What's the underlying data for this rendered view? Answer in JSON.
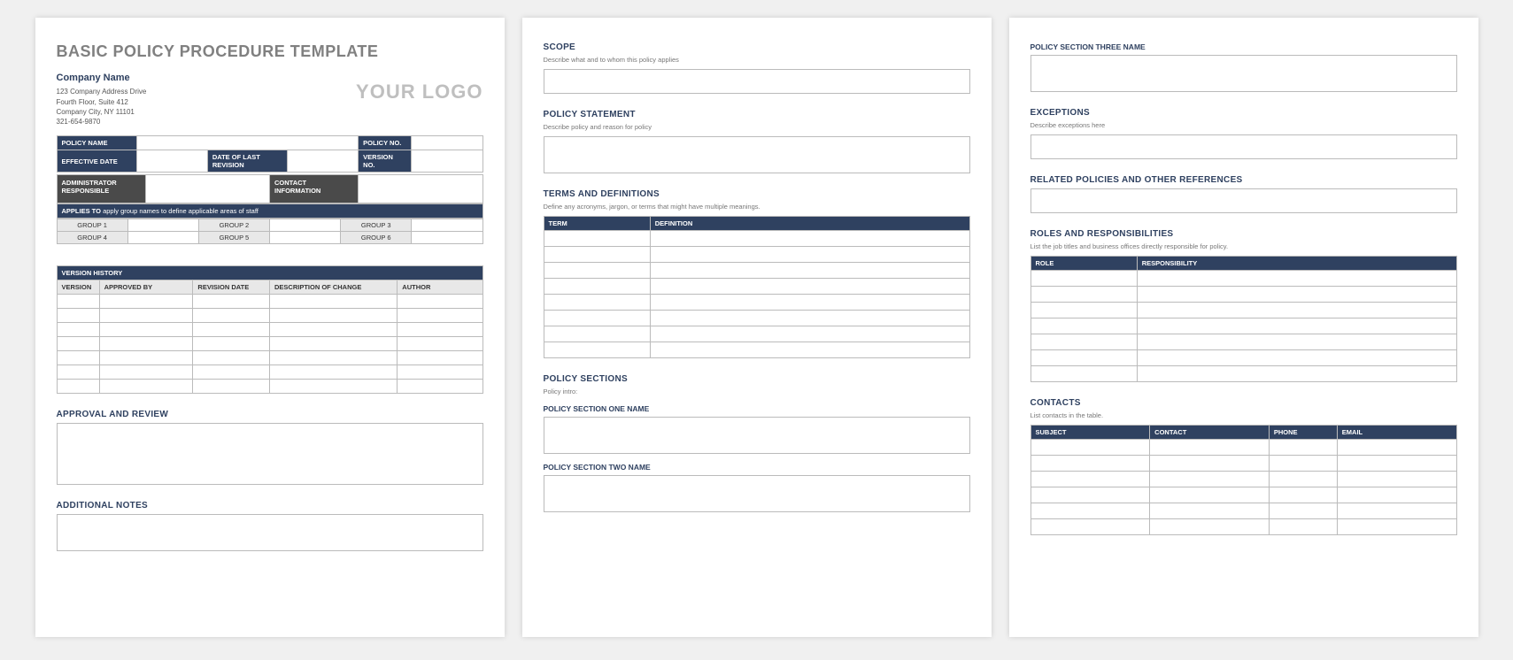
{
  "doc": {
    "title": "BASIC POLICY PROCEDURE TEMPLATE",
    "company_name": "Company Name",
    "addr1": "123 Company Address Drive",
    "addr2": "Fourth Floor, Suite 412",
    "addr3": "Company City, NY  11101",
    "phone": "321-654-9870",
    "logo": "YOUR LOGO"
  },
  "meta": {
    "policy_name": "POLICY NAME",
    "policy_no": "POLICY NO.",
    "effective_date": "EFFECTIVE DATE",
    "date_last_rev": "DATE OF LAST REVISION",
    "version_no": "VERSION NO.",
    "admin_resp": "ADMINISTRATOR RESPONSIBLE",
    "contact_info": "CONTACT INFORMATION"
  },
  "applies": {
    "label": "APPLIES TO",
    "text": "apply group names to define applicable areas of staff",
    "g1": "GROUP 1",
    "g2": "GROUP 2",
    "g3": "GROUP 3",
    "g4": "GROUP 4",
    "g5": "GROUP 5",
    "g6": "GROUP 6"
  },
  "vh": {
    "title": "VERSION HISTORY",
    "c1": "VERSION",
    "c2": "APPROVED BY",
    "c3": "REVISION DATE",
    "c4": "DESCRIPTION OF CHANGE",
    "c5": "AUTHOR"
  },
  "p1": {
    "approval": "APPROVAL AND REVIEW",
    "notes": "ADDITIONAL NOTES"
  },
  "p2": {
    "scope_t": "SCOPE",
    "scope_s": "Describe what and to whom this policy applies",
    "stmt_t": "POLICY STATEMENT",
    "stmt_s": "Describe policy and reason for policy",
    "terms_t": "TERMS AND DEFINITIONS",
    "terms_s": "Define any acronyms, jargon, or terms that might have multiple meanings.",
    "term_col": "TERM",
    "def_col": "DEFINITION",
    "psec_t": "POLICY SECTIONS",
    "psec_s": "Policy intro:",
    "ps1": "POLICY SECTION ONE NAME",
    "ps2": "POLICY SECTION TWO NAME"
  },
  "p3": {
    "ps3": "POLICY SECTION THREE NAME",
    "exc_t": "EXCEPTIONS",
    "exc_s": "Describe exceptions here",
    "rel_t": "RELATED POLICIES AND OTHER REFERENCES",
    "roles_t": "ROLES AND RESPONSIBILITIES",
    "roles_s": "List the job titles and business offices directly responsible for policy.",
    "role_col": "ROLE",
    "resp_col": "RESPONSIBILITY",
    "contacts_t": "CONTACTS",
    "contacts_s": "List contacts in the table.",
    "cc1": "SUBJECT",
    "cc2": "CONTACT",
    "cc3": "PHONE",
    "cc4": "EMAIL"
  }
}
